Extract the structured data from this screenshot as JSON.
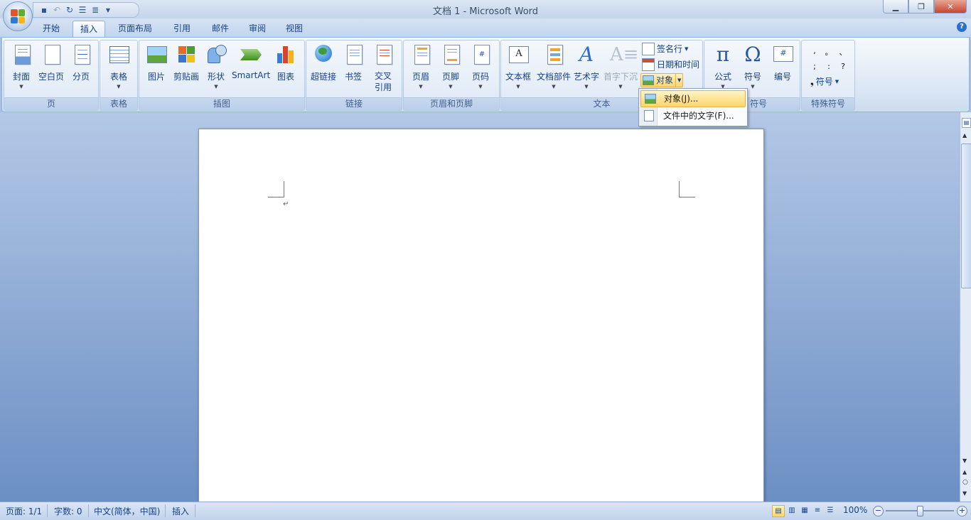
{
  "window": {
    "title": "文档 1 - Microsoft Word"
  },
  "tabs": [
    {
      "label": "开始"
    },
    {
      "label": "插入"
    },
    {
      "label": "页面布局"
    },
    {
      "label": "引用"
    },
    {
      "label": "邮件"
    },
    {
      "label": "审阅"
    },
    {
      "label": "视图"
    }
  ],
  "ribbon": {
    "groups": {
      "page": {
        "label": "页",
        "cover": "封面",
        "blank": "空白页",
        "break": "分页"
      },
      "table": {
        "label": "表格",
        "table": "表格"
      },
      "illustrations": {
        "label": "插图",
        "picture": "图片",
        "clipart": "剪贴画",
        "shapes": "形状",
        "smartart": "SmartArt",
        "chart": "图表"
      },
      "links": {
        "label": "链接",
        "hyperlink": "超链接",
        "bookmark": "书签",
        "crossref": "交叉引用"
      },
      "headerfooter": {
        "label": "页眉和页脚",
        "header": "页眉",
        "footer": "页脚",
        "pagenum": "页码"
      },
      "text": {
        "label": "文本",
        "textbox": "文本框",
        "quickparts": "文档部件",
        "wordart": "艺术字",
        "dropcap": "首字下沉",
        "signature": "签名行",
        "datetime": "日期和时间",
        "object": "对象"
      },
      "symbols": {
        "label": "符号",
        "label_visible": "符号",
        "equation": "公式",
        "symbol": "符号",
        "number": "编号"
      },
      "special": {
        "label": "特殊符号",
        "symbol": "符号",
        "chars": [
          ",",
          "。",
          "、",
          ";",
          ":",
          "?"
        ]
      }
    }
  },
  "object_menu": {
    "items": [
      {
        "label": "对象(J)..."
      },
      {
        "label": "文件中的文字(F)..."
      }
    ]
  },
  "document": {
    "paragraph_mark": "↵"
  },
  "statusbar": {
    "page": "页面: 1/1",
    "words": "字数: 0",
    "language": "中文(简体，中国)",
    "mode": "插入",
    "zoom": "100%"
  }
}
